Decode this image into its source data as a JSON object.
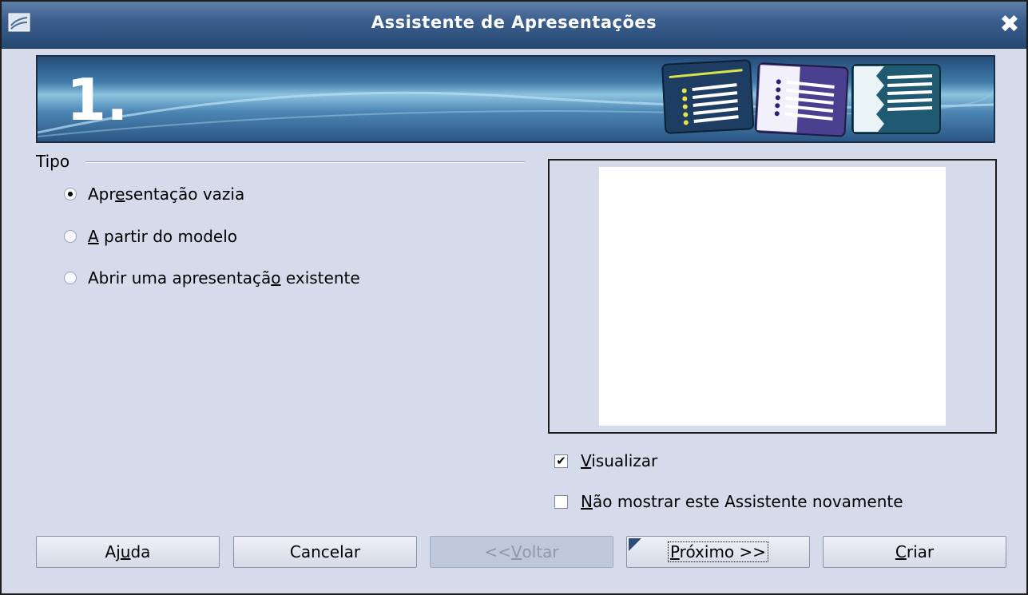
{
  "window": {
    "title": "Assistente de Apresentações",
    "close_icon": "close-icon",
    "app_icon": "presentation-app-icon"
  },
  "banner": {
    "step": "1."
  },
  "type_group": {
    "label": "Tipo",
    "options": [
      {
        "pre": "Apr",
        "mnemonic": "e",
        "post": "sentação vazia",
        "checked": true
      },
      {
        "pre": "",
        "mnemonic": "A",
        "post": " partir do modelo",
        "checked": false
      },
      {
        "pre": "Abrir uma apresentaçã",
        "mnemonic": "o",
        "post": " existente",
        "checked": false
      }
    ]
  },
  "preview": {
    "show_preview": {
      "mnemonic": "V",
      "post": "isualizar",
      "checked": true
    },
    "dont_show_again": {
      "mnemonic": "N",
      "post": "ão mostrar este Assistente novamente",
      "checked": false
    }
  },
  "buttons": {
    "help": {
      "pre": "Aj",
      "mnemonic": "u",
      "post": "da"
    },
    "cancel": {
      "label": "Cancelar"
    },
    "back": {
      "pre": "<< ",
      "mnemonic": "V",
      "post": "oltar",
      "enabled": false
    },
    "next": {
      "mnemonic": "P",
      "post": "róximo >>"
    },
    "create": {
      "mnemonic": "C",
      "post": "riar"
    }
  },
  "colors": {
    "dialog_bg": "#d5dbeb",
    "titlebar": "#3d5f8d",
    "banner": "#2a5684"
  }
}
